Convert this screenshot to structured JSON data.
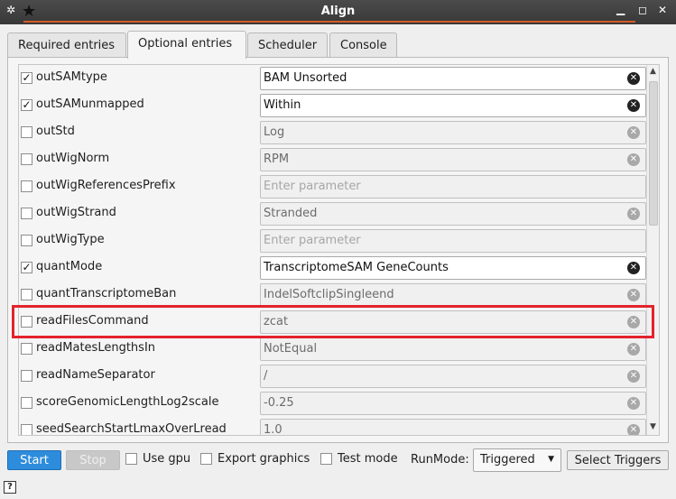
{
  "window": {
    "title": "Align"
  },
  "tabs": [
    {
      "label": "Required entries"
    },
    {
      "label": "Optional entries"
    },
    {
      "label": "Scheduler"
    },
    {
      "label": "Console"
    }
  ],
  "rows": [
    {
      "name": "outSAMtype",
      "checked": true,
      "value": "BAM Unsorted",
      "placeholder": "",
      "clearable": true
    },
    {
      "name": "outSAMunmapped",
      "checked": true,
      "value": "Within",
      "placeholder": "",
      "clearable": true
    },
    {
      "name": "outStd",
      "checked": false,
      "value": "Log",
      "placeholder": "",
      "clearable": true
    },
    {
      "name": "outWigNorm",
      "checked": false,
      "value": "RPM",
      "placeholder": "",
      "clearable": true
    },
    {
      "name": "outWigReferencesPrefix",
      "checked": false,
      "value": "",
      "placeholder": "Enter parameter",
      "clearable": false
    },
    {
      "name": "outWigStrand",
      "checked": false,
      "value": "Stranded",
      "placeholder": "",
      "clearable": true
    },
    {
      "name": "outWigType",
      "checked": false,
      "value": "",
      "placeholder": "Enter parameter",
      "clearable": false
    },
    {
      "name": "quantMode",
      "checked": true,
      "value": "TranscriptomeSAM GeneCounts",
      "placeholder": "",
      "clearable": true
    },
    {
      "name": "quantTranscriptomeBan",
      "checked": false,
      "value": "IndelSoftclipSingleend",
      "placeholder": "",
      "clearable": true
    },
    {
      "name": "readFilesCommand",
      "checked": false,
      "value": "zcat",
      "placeholder": "",
      "clearable": true
    },
    {
      "name": "readMatesLengthsIn",
      "checked": false,
      "value": "NotEqual",
      "placeholder": "",
      "clearable": true
    },
    {
      "name": "readNameSeparator",
      "checked": false,
      "value": "/",
      "placeholder": "",
      "clearable": true
    },
    {
      "name": "scoreGenomicLengthLog2scale",
      "checked": false,
      "value": "-0.25",
      "placeholder": "",
      "clearable": true
    },
    {
      "name": "seedSearchStartLmaxOverLread",
      "checked": false,
      "value": "1.0",
      "placeholder": "",
      "clearable": true
    }
  ],
  "bottom": {
    "start": "Start",
    "stop": "Stop",
    "use_gpu": "Use gpu",
    "export_graphics": "Export graphics",
    "test_mode": "Test mode",
    "runmode_label": "RunMode:",
    "runmode_value": "Triggered",
    "select_triggers": "Select Triggers"
  },
  "help": "?",
  "colors": {
    "accent": "#2d8cdc",
    "highlight": "#e3232c",
    "title_underline": "#d35b2a"
  }
}
